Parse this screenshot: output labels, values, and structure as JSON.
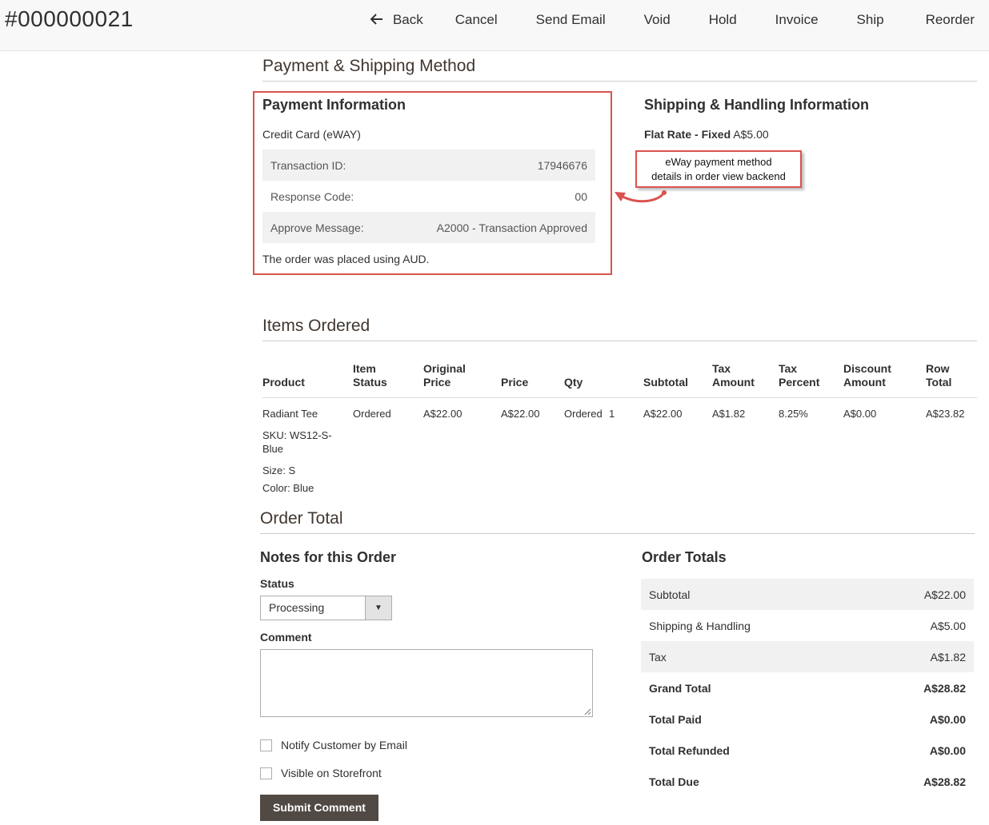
{
  "header": {
    "order_number": "#000000021",
    "actions": {
      "back": "Back",
      "cancel": "Cancel",
      "send_email": "Send Email",
      "void": "Void",
      "hold": "Hold",
      "invoice": "Invoice",
      "ship": "Ship",
      "reorder": "Reorder"
    }
  },
  "payment_shipping": {
    "title": "Payment & Shipping Method",
    "payment": {
      "title": "Payment Information",
      "method": "Credit Card (eWAY)",
      "rows": [
        {
          "label": "Transaction ID:",
          "value": "17946676"
        },
        {
          "label": "Response Code:",
          "value": "00"
        },
        {
          "label": "Approve Message:",
          "value": "A2000 - Transaction Approved"
        }
      ],
      "currency_note": "The order was placed using AUD."
    },
    "shipping": {
      "title": "Shipping & Handling Information",
      "method_bold": "Flat Rate - Fixed",
      "method_price": "A$5.00"
    },
    "annotation": {
      "line1": "eWay payment method",
      "line2": "details in order view backend",
      "color": "#d9534f"
    }
  },
  "items": {
    "title": "Items Ordered",
    "columns": {
      "product": "Product",
      "item_status_1": "Item",
      "item_status_2": "Status",
      "original_price_1": "Original",
      "original_price_2": "Price",
      "price": "Price",
      "qty": "Qty",
      "subtotal": "Subtotal",
      "tax_amount_1": "Tax",
      "tax_amount_2": "Amount",
      "tax_percent_1": "Tax",
      "tax_percent_2": "Percent",
      "discount_amount_1": "Discount",
      "discount_amount_2": "Amount",
      "row_total_1": "Row",
      "row_total_2": "Total"
    },
    "rows": [
      {
        "product": "Radiant Tee",
        "sku_1": "SKU: WS12-S-",
        "sku_2": "Blue",
        "size": "Size:  S",
        "color": "Color:  Blue",
        "status": "Ordered",
        "original_price": "A$22.00",
        "price": "A$22.00",
        "qty_label": "Ordered",
        "qty_value": "1",
        "subtotal": "A$22.00",
        "tax_amount": "A$1.82",
        "tax_percent": "8.25%",
        "discount": "A$0.00",
        "row_total": "A$23.82"
      }
    ]
  },
  "order_total": {
    "title": "Order Total",
    "notes": {
      "title": "Notes for this Order",
      "status_label": "Status",
      "status_value": "Processing",
      "comment_label": "Comment",
      "comment_value": "",
      "notify_label": "Notify Customer by Email",
      "visible_label": "Visible on Storefront",
      "submit_label": "Submit Comment"
    },
    "totals": {
      "title": "Order Totals",
      "rows": [
        {
          "label": "Subtotal",
          "value": "A$22.00"
        },
        {
          "label": "Shipping & Handling",
          "value": "A$5.00"
        },
        {
          "label": "Tax",
          "value": "A$1.82"
        },
        {
          "label": "Grand Total",
          "value": "A$28.82"
        },
        {
          "label": "Total Paid",
          "value": "A$0.00"
        },
        {
          "label": "Total Refunded",
          "value": "A$0.00"
        },
        {
          "label": "Total Due",
          "value": "A$28.82"
        }
      ]
    }
  }
}
